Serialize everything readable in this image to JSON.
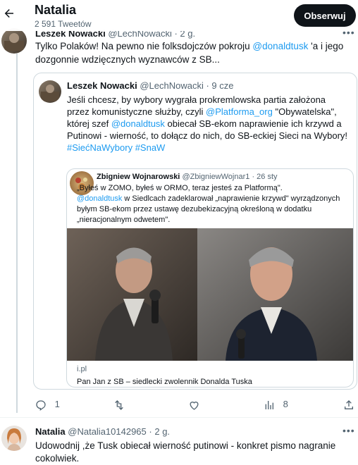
{
  "header": {
    "name": "Natalia",
    "tweet_count": "2 591 Tweetów",
    "follow_label": "Obserwuj",
    "back_icon": "arrow-left-icon"
  },
  "tweet": {
    "author_name": "Leszek Nowacki",
    "author_handle": "@LechNowacki",
    "time": "· 2 g.",
    "text_before": "Tylko Polaków! Na pewno nie folksdojczów pokroju ",
    "mention": "@donaldtusk",
    "text_after": " 'a i jego dozgonnie wdzięcznych wyznawców z SB...",
    "quote": {
      "author_name": "Leszek Nowacki",
      "author_handle": "@LechNowacki",
      "time": "· 9 cze",
      "p1": "Jeśli chcesz, by wybory wygrała prokremlowska partia założona przez komunistyczne służby, czyli ",
      "mention1": "@Platforma_org",
      "p2": " \"Obywatelska\", której szef ",
      "mention2": "@donaldtusk",
      "p3": " obiecał SB-ekom naprawienie ich krzywd a Putinowi - wierność, to dołącz do nich, do SB-eckiej Sieci na Wybory!",
      "hashtags": "#SiećNaWybory #SnaW",
      "nested": {
        "author_name": "Zbigniew Wojnarowski",
        "author_handle": "@ZbigniewWojnar1",
        "time": "· 26 sty",
        "line1": "„Byłeś w ZOMO, byłeś w ORMO, teraz jesteś za Platformą\".",
        "mention": "@donaldtusk",
        "line2": " w Siedlcach zadeklarował „naprawienie krzywd\" wyrządzonych byłym SB-ekom przez ustawę dezubekizacyjną określoną w dodatku „nieracjonalnym odwetem\".",
        "card_domain": "i.pl",
        "card_title": "Pan Jan z SB – siedlecki zwolennik Donalda Tuska"
      }
    },
    "actions": {
      "replies": "1",
      "likes": "",
      "views": "8"
    }
  },
  "reply": {
    "author_name": "Natalia",
    "author_handle": "@Natalia10142965",
    "time": "· 2 g.",
    "text": "Udowodnij ,że Tusk obiecał wierność putinowi - konkret pismo nagranie cokolwiek."
  }
}
